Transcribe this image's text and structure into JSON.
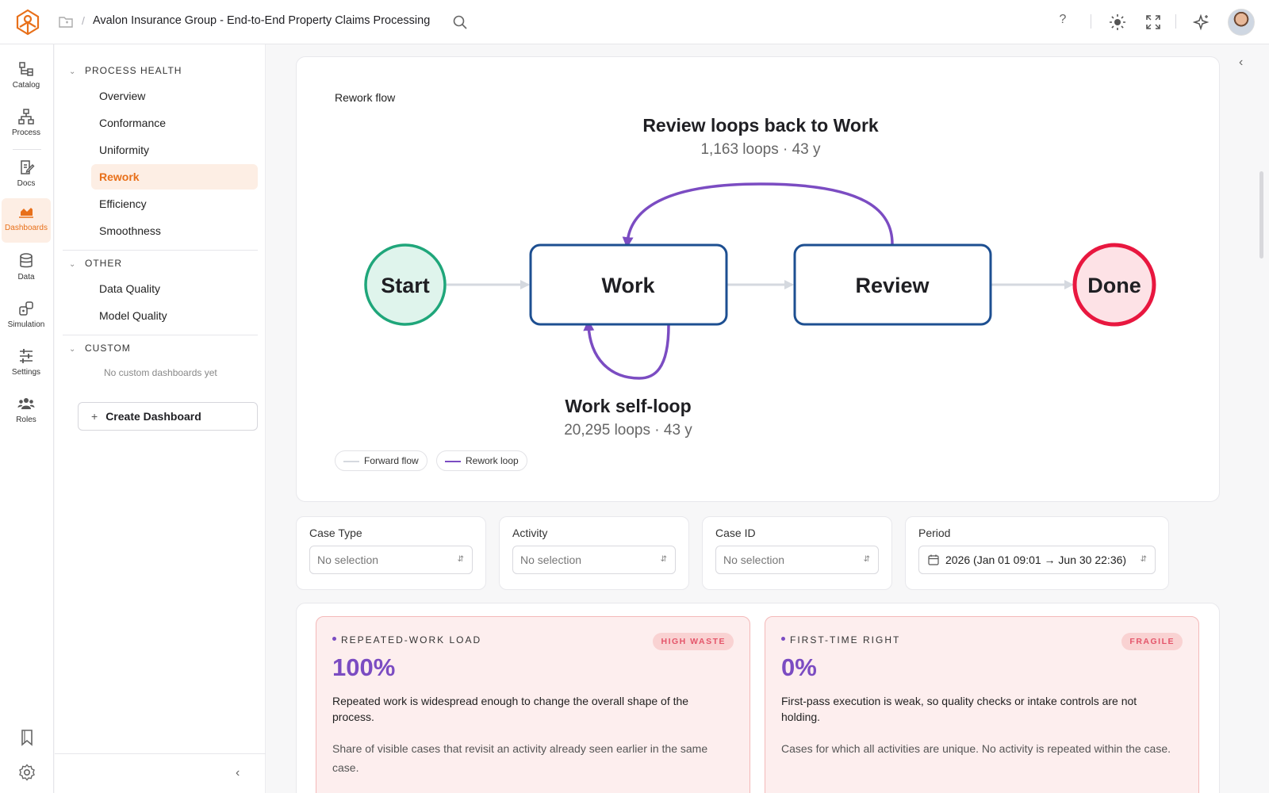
{
  "header": {
    "breadcrumb_sep": "/",
    "title": "Avalon Insurance Group - End-to-End Property Claims Processing",
    "help": "?"
  },
  "rail": {
    "items": [
      {
        "label": "Catalog",
        "icon": "catalog-icon"
      },
      {
        "label": "Process",
        "icon": "process-icon"
      },
      {
        "label": "Docs",
        "icon": "docs-icon"
      },
      {
        "label": "Dashboards",
        "icon": "dashboards-icon",
        "active": true
      },
      {
        "label": "Data",
        "icon": "database-icon"
      },
      {
        "label": "Simulation",
        "icon": "simulation-icon"
      },
      {
        "label": "Settings",
        "icon": "sliders-icon"
      },
      {
        "label": "Roles",
        "icon": "users-icon"
      }
    ]
  },
  "nav": {
    "sections": [
      {
        "title": "PROCESS HEALTH",
        "items": [
          "Overview",
          "Conformance",
          "Uniformity",
          "Rework",
          "Efficiency",
          "Smoothness"
        ]
      },
      {
        "title": "OTHER",
        "items": [
          "Data Quality",
          "Model Quality"
        ]
      },
      {
        "title": "CUSTOM",
        "items": []
      }
    ],
    "active_item": "Rework",
    "custom_empty": "No custom dashboards yet",
    "create_button": "Create Dashboard",
    "create_plus": "+"
  },
  "flow": {
    "label": "Rework flow",
    "top_loop_title": "Review loops back to Work",
    "top_loop_stats": "1,163 loops · 43 y",
    "self_loop_title": "Work self-loop",
    "self_loop_stats": "20,295 loops · 43 y",
    "nodes": {
      "start": "Start",
      "work": "Work",
      "review": "Review",
      "done": "Done"
    },
    "legend": {
      "forward": "Forward flow",
      "rework": "Rework loop"
    },
    "colors": {
      "start": "#1fa67a",
      "done": "#e8173f",
      "task": "#1d4f91",
      "rework": "#7b4cc2",
      "forward": "#d5d9df"
    }
  },
  "filters": [
    {
      "label": "Case Type",
      "value": "No selection"
    },
    {
      "label": "Activity",
      "value": "No selection"
    },
    {
      "label": "Case ID",
      "value": "No selection"
    },
    {
      "label": "Period",
      "value": "2026 (Jan 01 09:01 → Jun 30 22:36)"
    }
  ],
  "kpis": [
    {
      "title": "REPEATED-WORK LOAD",
      "badge": "HIGH WASTE",
      "value": "100%",
      "description": "Repeated work is widespread enough to change the overall shape of the process.",
      "note": "Share of visible cases that revisit an activity already seen earlier in the same case."
    },
    {
      "title": "FIRST-TIME RIGHT",
      "badge": "FRAGILE",
      "value": "0%",
      "description": "First-pass execution is weak, so quality checks or intake controls are not holding.",
      "note": "Cases for which all activities are unique. No activity is repeated within the case."
    }
  ]
}
